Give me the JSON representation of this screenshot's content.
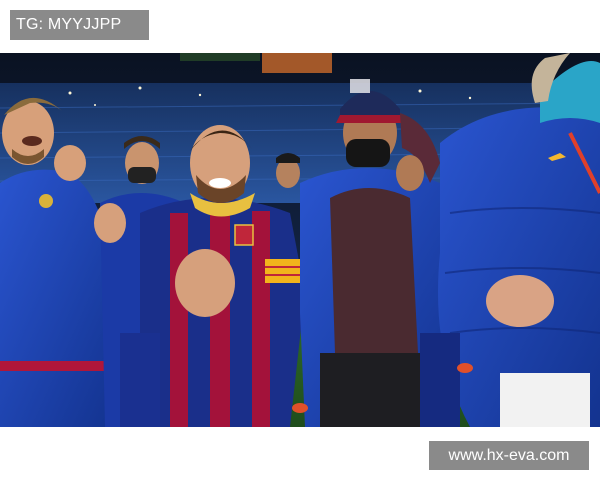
{
  "watermark_top": {
    "text": "TG: MYYJJPP"
  },
  "watermark_bottom": {
    "text": "www.hx-eva.com"
  },
  "photo": {
    "subject": "Football players and a companion celebrating on a pitch at night in a stadium",
    "colors": {
      "stadium_dark": "#0c1426",
      "seats_blue": "#1d3f7a",
      "pitch_green": "#2f6a2a",
      "jacket_blue": "#1c3fae",
      "jersey_blue": "#1a2f8a",
      "jersey_red": "#a3123a",
      "captain_band": "#f2b41c",
      "hoodie_maroon": "#4a2a30"
    }
  }
}
